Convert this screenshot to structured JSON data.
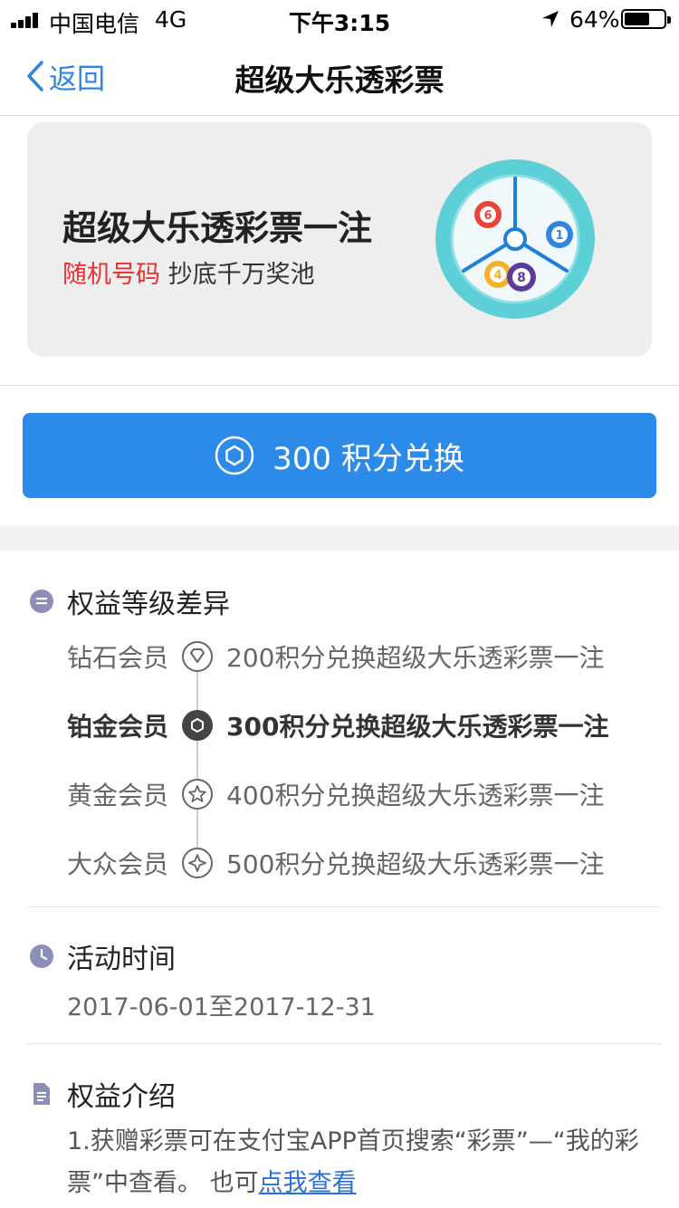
{
  "status_bar": {
    "carrier": "中国电信",
    "network": "4G",
    "time": "下午3:15",
    "battery_percent": "64%",
    "battery_level": 0.64,
    "icons": [
      "signal-icon",
      "location-arrow-icon",
      "battery-icon"
    ]
  },
  "nav": {
    "back_label": "返回",
    "title": "超级大乐透彩票"
  },
  "card": {
    "title": "超级大乐透彩票一注",
    "highlight": "随机号码",
    "subtitle": "抄底千万奖池",
    "ball_numbers": [
      "6",
      "1",
      "4",
      "8"
    ]
  },
  "redeem": {
    "label": "300 积分兑换",
    "icon": "hexagon-badge-icon"
  },
  "levels": {
    "title": "权益等级差异",
    "tiers": [
      {
        "name": "钻石会员",
        "desc": "200积分兑换超级大乐透彩票一注",
        "icon": "diamond-icon"
      },
      {
        "name": "铂金会员",
        "desc": "300积分兑换超级大乐透彩票一注",
        "icon": "hexagon-icon"
      },
      {
        "name": "黄金会员",
        "desc": "400积分兑换超级大乐透彩票一注",
        "icon": "star-icon"
      },
      {
        "name": "大众会员",
        "desc": "500积分兑换超级大乐透彩票一注",
        "icon": "sparkle-icon"
      }
    ]
  },
  "activity": {
    "title": "活动时间",
    "range": "2017-06-01至2017-12-31"
  },
  "intro": {
    "title": "权益介绍",
    "text": "1.获赠彩票可在支付宝APP首页搜索“彩票”—“我的彩票”中查看。 也可",
    "link": "点我查看"
  },
  "colors": {
    "accent": "#2c8ae9",
    "highlight_red": "#e8302e",
    "link": "#2c6fd6"
  }
}
